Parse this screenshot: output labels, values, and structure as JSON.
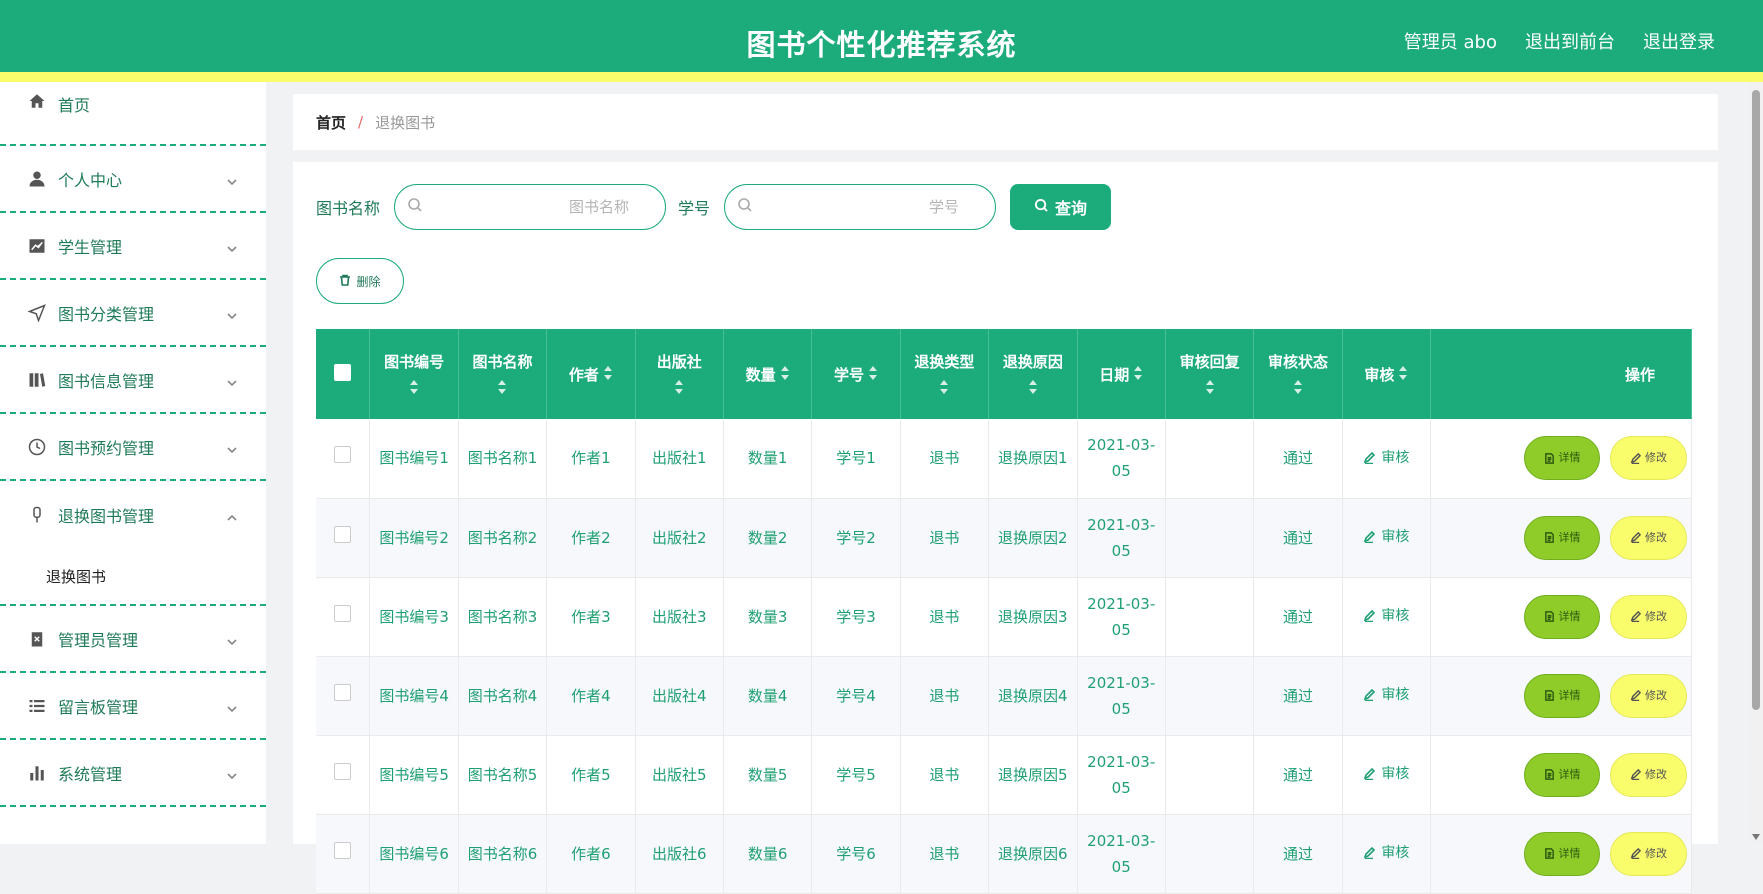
{
  "header": {
    "title": "图书个性化推荐系统",
    "user": "管理员 abo",
    "to_front": "退出到前台",
    "logout": "退出登录"
  },
  "sidebar": {
    "items": [
      {
        "label": "首页",
        "icon": "home-icon"
      },
      {
        "label": "个人中心",
        "icon": "user-icon"
      },
      {
        "label": "学生管理",
        "icon": "chart-icon"
      },
      {
        "label": "图书分类管理",
        "icon": "navigation-icon"
      },
      {
        "label": "图书信息管理",
        "icon": "books-icon"
      },
      {
        "label": "图书预约管理",
        "icon": "clock-icon"
      },
      {
        "label": "退换图书管理",
        "icon": "microphone-icon"
      },
      {
        "label": "管理员管理",
        "icon": "clipboard-icon"
      },
      {
        "label": "留言板管理",
        "icon": "list-icon"
      },
      {
        "label": "系统管理",
        "icon": "bar-chart-icon"
      }
    ],
    "submenu_active": "退换图书"
  },
  "breadcrumb": {
    "home": "首页",
    "separator": "/",
    "current": "退换图书"
  },
  "search": {
    "book_name_label": "图书名称",
    "book_name_placeholder": "图书名称",
    "student_no_label": "学号",
    "student_no_placeholder": "学号",
    "query_label": "查询",
    "delete_label": "删除"
  },
  "table": {
    "headers": [
      "图书编号",
      "图书名称",
      "作者",
      "出版社",
      "数量",
      "学号",
      "退换类型",
      "退换原因",
      "日期",
      "审核回复",
      "审核状态",
      "审核",
      "操作"
    ],
    "audit_label": "审核",
    "detail_label": "详情",
    "edit_label": "修改",
    "rows": [
      {
        "book_no": "图书编号1",
        "book_name": "图书名称1",
        "author": "作者1",
        "publisher": "出版社1",
        "qty": "数量1",
        "student_no": "学号1",
        "type": "退书",
        "reason": "退换原因1",
        "date": "2021-03-05",
        "reply": "",
        "status": "通过"
      },
      {
        "book_no": "图书编号2",
        "book_name": "图书名称2",
        "author": "作者2",
        "publisher": "出版社2",
        "qty": "数量2",
        "student_no": "学号2",
        "type": "退书",
        "reason": "退换原因2",
        "date": "2021-03-05",
        "reply": "",
        "status": "通过"
      },
      {
        "book_no": "图书编号3",
        "book_name": "图书名称3",
        "author": "作者3",
        "publisher": "出版社3",
        "qty": "数量3",
        "student_no": "学号3",
        "type": "退书",
        "reason": "退换原因3",
        "date": "2021-03-05",
        "reply": "",
        "status": "通过"
      },
      {
        "book_no": "图书编号4",
        "book_name": "图书名称4",
        "author": "作者4",
        "publisher": "出版社4",
        "qty": "数量4",
        "student_no": "学号4",
        "type": "退书",
        "reason": "退换原因4",
        "date": "2021-03-05",
        "reply": "",
        "status": "通过"
      },
      {
        "book_no": "图书编号5",
        "book_name": "图书名称5",
        "author": "作者5",
        "publisher": "出版社5",
        "qty": "数量5",
        "student_no": "学号5",
        "type": "退书",
        "reason": "退换原因5",
        "date": "2021-03-05",
        "reply": "",
        "status": "通过"
      },
      {
        "book_no": "图书编号6",
        "book_name": "图书名称6",
        "author": "作者6",
        "publisher": "出版社6",
        "qty": "数量6",
        "student_no": "学号6",
        "type": "退书",
        "reason": "退换原因6",
        "date": "2021-03-05",
        "reply": "",
        "status": "通过"
      }
    ]
  },
  "colors": {
    "primary": "#1cab7a",
    "accent_yellow": "#fafd6b",
    "detail_green": "#8fcc2a",
    "text_green": "#1f9f72"
  }
}
